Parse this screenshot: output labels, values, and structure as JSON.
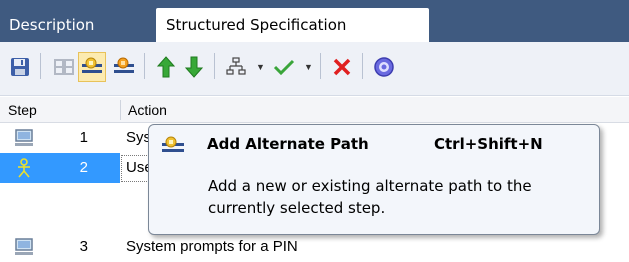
{
  "tabs": [
    {
      "label": "Description",
      "selected": false
    },
    {
      "label": "Structured Specification",
      "selected": true
    }
  ],
  "toolbar": {
    "buttons": [
      {
        "icon": "save-icon",
        "tooltip": ""
      },
      {
        "icon": "insert-step-icon",
        "enabled": false
      },
      {
        "icon": "add-alternate-path-icon",
        "active": true
      },
      {
        "icon": "add-exception-path-icon"
      },
      {
        "icon": "move-up-icon",
        "color": "#2aa12a"
      },
      {
        "icon": "move-down-icon",
        "color": "#2aa12a"
      },
      {
        "icon": "generate-structure-icon",
        "dropdown": true
      },
      {
        "icon": "check-icon",
        "dropdown": true,
        "color": "#2aa12a"
      },
      {
        "icon": "delete-icon",
        "color": "#e02020"
      },
      {
        "icon": "help-icon",
        "color": "#5b5bd6"
      }
    ]
  },
  "grid": {
    "columns": [
      "Step",
      "Action"
    ],
    "rows": [
      {
        "actor": "system",
        "num": "1",
        "action": "System",
        "selected": false
      },
      {
        "actor": "user",
        "num": "2",
        "action": "User",
        "selected": true
      },
      {
        "actor": "system",
        "num": "3",
        "action": "System prompts for a PIN",
        "selected": false
      }
    ]
  },
  "tooltip": {
    "title": "Add Alternate Path",
    "shortcut": "Ctrl+Shift+N",
    "description": "Add a new or existing alternate path to the currently selected step."
  },
  "colors": {
    "tab_bar": "#3f5a80",
    "toolbar_bg": "#eef1f7",
    "selection": "#3399ff",
    "active_button": "#fcebb0"
  }
}
